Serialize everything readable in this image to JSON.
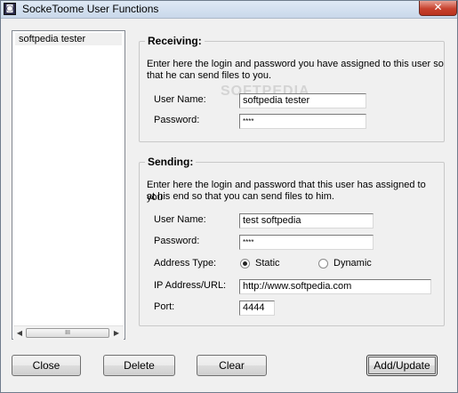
{
  "window": {
    "title": "SockeToome User Functions"
  },
  "user_list": {
    "items": [
      "softpedia tester"
    ]
  },
  "receiving": {
    "title": "Receiving:",
    "description_line1": "Enter here the login and password you have assigned to this user so",
    "description_line2": "that he can send files to you.",
    "user_name_label": "User Name:",
    "user_name_value": "softpedia tester",
    "password_label": "Password:",
    "password_value": "****"
  },
  "sending": {
    "title": "Sending:",
    "description_line1": "Enter here the login and password that this user has assigned to you",
    "description_line2": "at his end so that you can send files to him.",
    "user_name_label": "User Name:",
    "user_name_value": "test softpedia",
    "password_label": "Password:",
    "password_value": "****",
    "address_type_label": "Address Type:",
    "static_label": "Static",
    "dynamic_label": "Dynamic",
    "address_type_selected": "Static",
    "ip_label": "IP Address/URL:",
    "ip_value": "http://www.softpedia.com",
    "port_label": "Port:",
    "port_value": "4444"
  },
  "buttons": {
    "close": "Close",
    "delete": "Delete",
    "clear": "Clear",
    "add_update": "Add/Update"
  },
  "watermark": "SOFTPEDIA"
}
